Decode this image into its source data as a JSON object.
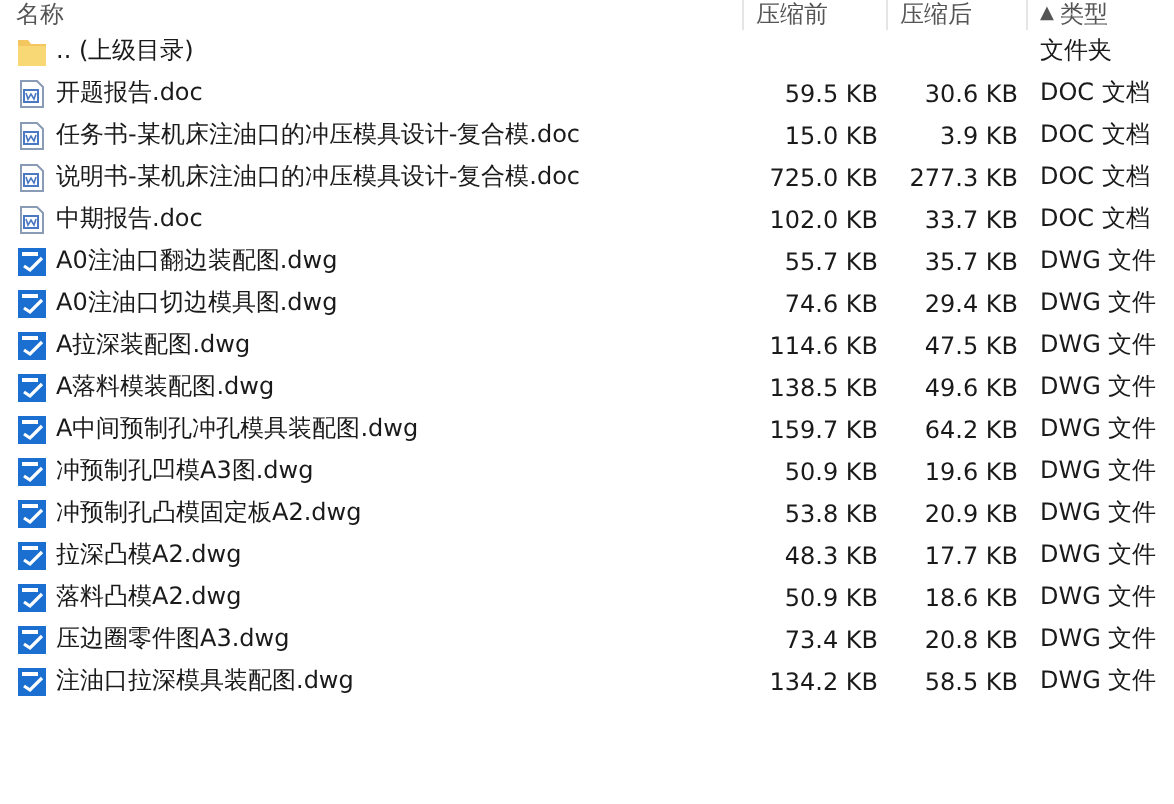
{
  "columns": [
    {
      "label": "名称"
    },
    {
      "label": "压缩前"
    },
    {
      "label": "压缩后"
    },
    {
      "label": "类型",
      "sort": "▲"
    }
  ],
  "rows": [
    {
      "kind": "folder",
      "name": ".. (上级目录)",
      "type": "文件夹"
    },
    {
      "kind": "doc",
      "name": "开题报告.doc",
      "size": "59.5 KB",
      "packed": "30.6 KB",
      "type": "DOC 文档"
    },
    {
      "kind": "doc",
      "name": "任务书-某机床注油口的冲压模具设计-复合模.doc",
      "size": "15.0 KB",
      "packed": "3.9 KB",
      "type": "DOC 文档"
    },
    {
      "kind": "doc",
      "name": "说明书-某机床注油口的冲压模具设计-复合模.doc",
      "size": "725.0 KB",
      "packed": "277.3 KB",
      "type": "DOC 文档"
    },
    {
      "kind": "doc",
      "name": "中期报告.doc",
      "size": "102.0 KB",
      "packed": "33.7 KB",
      "type": "DOC 文档"
    },
    {
      "kind": "dwg",
      "name": "A0注油口翻边装配图.dwg",
      "size": "55.7 KB",
      "packed": "35.7 KB",
      "type": "DWG 文件"
    },
    {
      "kind": "dwg",
      "name": "A0注油口切边模具图.dwg",
      "size": "74.6 KB",
      "packed": "29.4 KB",
      "type": "DWG 文件"
    },
    {
      "kind": "dwg",
      "name": "A拉深装配图.dwg",
      "size": "114.6 KB",
      "packed": "47.5 KB",
      "type": "DWG 文件"
    },
    {
      "kind": "dwg",
      "name": "A落料模装配图.dwg",
      "size": "138.5 KB",
      "packed": "49.6 KB",
      "type": "DWG 文件"
    },
    {
      "kind": "dwg",
      "name": "A中间预制孔冲孔模具装配图.dwg",
      "size": "159.7 KB",
      "packed": "64.2 KB",
      "type": "DWG 文件"
    },
    {
      "kind": "dwg",
      "name": "冲预制孔凹模A3图.dwg",
      "size": "50.9 KB",
      "packed": "19.6 KB",
      "type": "DWG 文件"
    },
    {
      "kind": "dwg",
      "name": "冲预制孔凸模固定板A2.dwg",
      "size": "53.8 KB",
      "packed": "20.9 KB",
      "type": "DWG 文件"
    },
    {
      "kind": "dwg",
      "name": "拉深凸模A2.dwg",
      "size": "48.3 KB",
      "packed": "17.7 KB",
      "type": "DWG 文件"
    },
    {
      "kind": "dwg",
      "name": "落料凸模A2.dwg",
      "size": "50.9 KB",
      "packed": "18.6 KB",
      "type": "DWG 文件"
    },
    {
      "kind": "dwg",
      "name": "压边圈零件图A3.dwg",
      "size": "73.4 KB",
      "packed": "20.8 KB",
      "type": "DWG 文件"
    },
    {
      "kind": "dwg",
      "name": "注油口拉深模具装配图.dwg",
      "size": "134.2 KB",
      "packed": "58.5 KB",
      "type": "DWG 文件"
    }
  ]
}
